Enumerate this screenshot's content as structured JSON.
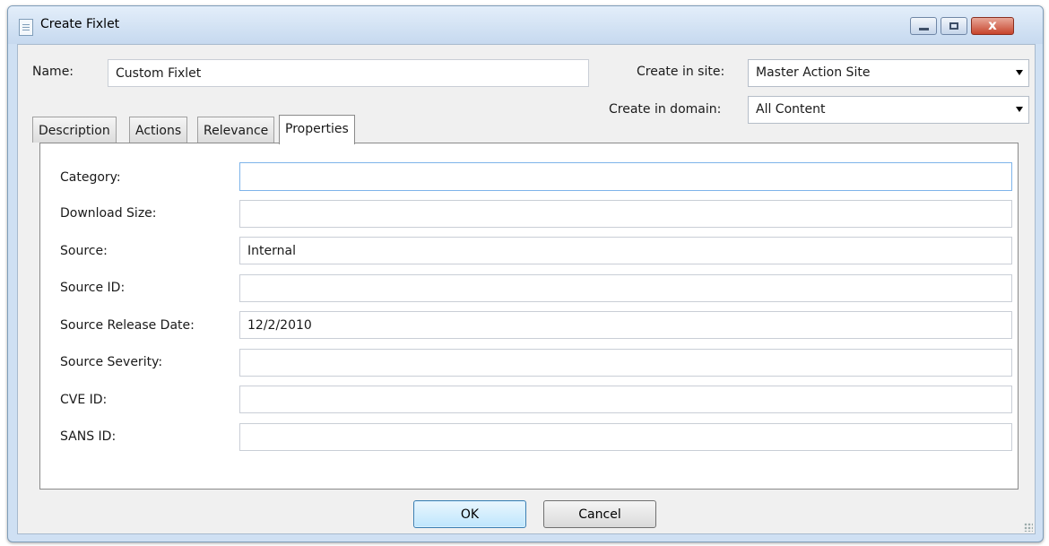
{
  "window": {
    "title": "Create Fixlet",
    "close_glyph": "x"
  },
  "form": {
    "name_label": "Name:",
    "name_value": "Custom Fixlet",
    "site_label": "Create in site:",
    "site_value": "Master Action Site",
    "domain_label": "Create in domain:",
    "domain_value": "All Content"
  },
  "tabs": [
    {
      "label": "Description"
    },
    {
      "label": "Actions"
    },
    {
      "label": "Relevance"
    },
    {
      "label": "Properties"
    }
  ],
  "properties": [
    {
      "label": "Category:",
      "value": ""
    },
    {
      "label": "Download Size:",
      "value": ""
    },
    {
      "label": "Source:",
      "value": "Internal"
    },
    {
      "label": "Source ID:",
      "value": ""
    },
    {
      "label": "Source Release Date:",
      "value": "12/2/2010"
    },
    {
      "label": "Source Severity:",
      "value": ""
    },
    {
      "label": "CVE ID:",
      "value": ""
    },
    {
      "label": "SANS ID:",
      "value": ""
    }
  ],
  "buttons": {
    "ok": "OK",
    "cancel": "Cancel"
  },
  "colors": {
    "accent": "#3c7fb1",
    "title_bar": "#cfe0f3"
  }
}
